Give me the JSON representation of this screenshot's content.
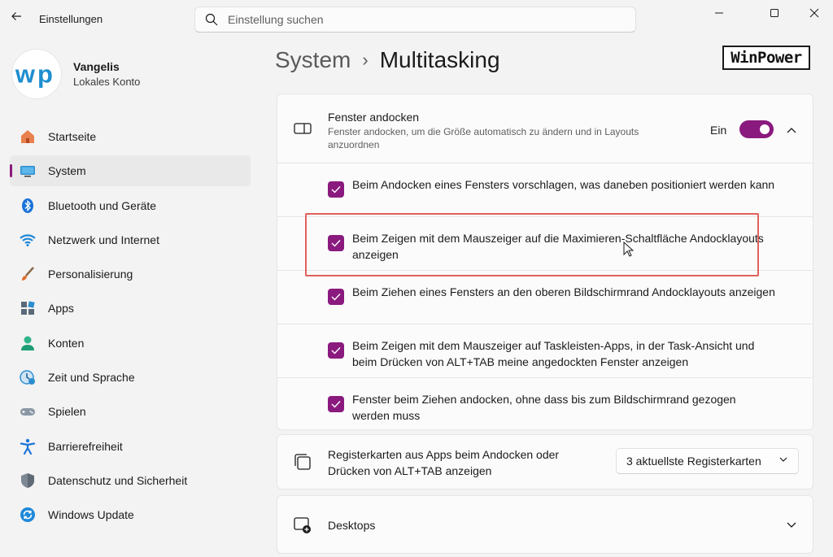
{
  "app": {
    "title": "Einstellungen"
  },
  "search": {
    "placeholder": "Einstellung suchen"
  },
  "profile": {
    "name": "Vangelis",
    "account": "Lokales Konto"
  },
  "colors": {
    "accent": "#8a1a7e",
    "highlight": "#e0605c"
  },
  "sidebar": {
    "items": [
      {
        "label": "Startseite",
        "icon": "home-icon"
      },
      {
        "label": "System",
        "icon": "system-display-icon",
        "selected": true
      },
      {
        "label": "Bluetooth und Geräte",
        "icon": "bluetooth-icon"
      },
      {
        "label": "Netzwerk und Internet",
        "icon": "wifi-icon"
      },
      {
        "label": "Personalisierung",
        "icon": "brush-icon"
      },
      {
        "label": "Apps",
        "icon": "apps-icon"
      },
      {
        "label": "Konten",
        "icon": "account-icon"
      },
      {
        "label": "Zeit und Sprache",
        "icon": "clock-globe-icon"
      },
      {
        "label": "Spielen",
        "icon": "gamepad-icon"
      },
      {
        "label": "Barrierefreiheit",
        "icon": "accessibility-icon"
      },
      {
        "label": "Datenschutz und Sicherheit",
        "icon": "shield-icon"
      },
      {
        "label": "Windows Update",
        "icon": "update-icon"
      }
    ]
  },
  "header": {
    "parent": "System",
    "separator": "›",
    "current": "Multitasking"
  },
  "watermark": "WinPower",
  "snap": {
    "title": "Fenster andocken",
    "description": "Fenster andocken, um die Größe automatisch zu ändern und in Layouts anzuordnen",
    "toggle_label": "Ein",
    "enabled": true,
    "options": [
      {
        "text": "Beim Andocken eines Fensters vorschlagen, was daneben positioniert werden kann",
        "checked": true
      },
      {
        "text": "Beim Zeigen mit dem Mauszeiger auf die Maximieren-Schaltfläche Andocklayouts anzeigen",
        "checked": true
      },
      {
        "text": "Beim Ziehen eines Fensters an den oberen Bildschirmrand Andocklayouts anzeigen",
        "checked": true
      },
      {
        "text": "Beim Zeigen mit dem Mauszeiger auf Taskleisten-Apps, in der Task-Ansicht und beim Drücken von ALT+TAB meine angedockten Fenster anzeigen",
        "checked": true
      },
      {
        "text": "Fenster beim Ziehen andocken, ohne dass bis zum Bildschirmrand gezogen werden muss",
        "checked": true
      }
    ]
  },
  "tabs_setting": {
    "text": "Registerkarten aus Apps beim Andocken oder Drücken von ALT+TAB anzeigen",
    "selected": "3 aktuellste Registerkarten"
  },
  "desktops": {
    "text": "Desktops"
  }
}
